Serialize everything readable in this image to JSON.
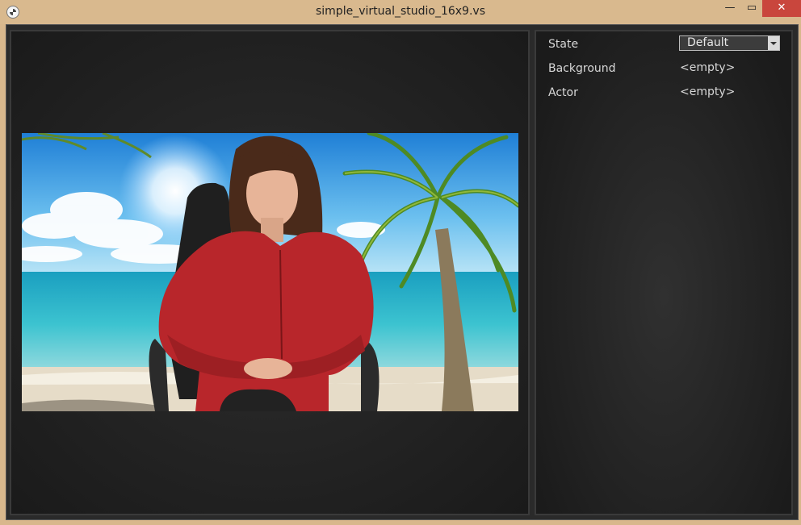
{
  "window": {
    "title": "simple_virtual_studio_16x9.vs",
    "minimize_glyph": "—",
    "maximize_glyph": "▭",
    "close_glyph": "✕"
  },
  "properties": {
    "state_label": "State",
    "state_value": "Default",
    "background_label": "Background",
    "background_value": "<empty>",
    "actor_label": "Actor",
    "actor_value": "<empty>"
  },
  "colors": {
    "title_bar": "#d9b98e",
    "close_button": "#c9463d",
    "panel_bg": "#1e1e1e"
  }
}
